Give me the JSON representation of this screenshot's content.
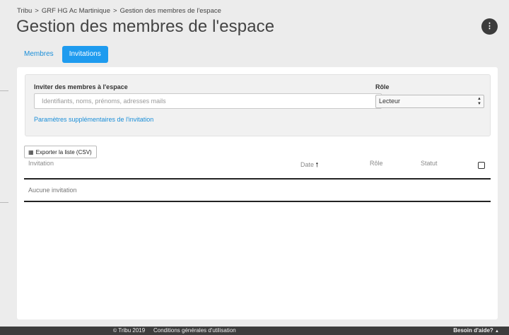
{
  "breadcrumb": {
    "items": [
      "Tribu",
      "GRF HG Ac Martinique",
      "Gestion des membres de l'espace"
    ],
    "separator": ">"
  },
  "page": {
    "title": "Gestion des membres de l'espace",
    "menu_icon": "kebab-menu-icon"
  },
  "tabs": [
    {
      "label": "Membres",
      "active": false
    },
    {
      "label": "Invitations",
      "active": true
    }
  ],
  "invite": {
    "label": "Inviter des membres à l'espace",
    "placeholder": "Identifiants, noms, prénoms, adresses mails",
    "role_label": "Rôle",
    "role_value": "Lecteur",
    "extra_link": "Paramètres supplémentaires de l'invitation"
  },
  "toolbar": {
    "export_label": "Exporter la liste (CSV)",
    "export_icon": "table-icon"
  },
  "table": {
    "columns": {
      "invitation": "Invitation",
      "date": "Date",
      "role": "Rôle",
      "status": "Statut"
    },
    "sort_icon": "arrow-up-icon",
    "empty_text": "Aucune invitation"
  },
  "footer": {
    "copyright": "Tribu 2019",
    "terms": "Conditions générales d'utilisation",
    "help": "Besoin d'aide?"
  },
  "colors": {
    "accent": "#1e9bef",
    "link": "#1a8ed8",
    "footer_bg": "#3d3d3d",
    "page_bg": "#ececec"
  }
}
